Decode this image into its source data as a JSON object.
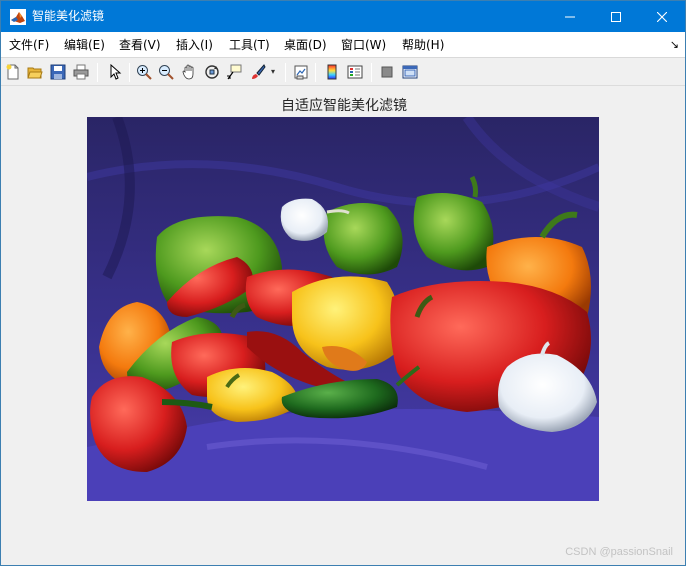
{
  "window": {
    "title": "智能美化滤镜"
  },
  "menu": {
    "items": [
      {
        "label": "文件(F)"
      },
      {
        "label": "编辑(E)"
      },
      {
        "label": "查看(V)"
      },
      {
        "label": "插入(I)"
      },
      {
        "label": "工具(T)"
      },
      {
        "label": "桌面(D)"
      },
      {
        "label": "窗口(W)"
      },
      {
        "label": "帮助(H)"
      }
    ]
  },
  "toolbar": {
    "icons": [
      "new-figure-icon",
      "open-icon",
      "save-icon",
      "print-icon",
      "pointer-icon",
      "zoom-in-icon",
      "zoom-out-icon",
      "pan-icon",
      "rotate-3d-icon",
      "data-cursor-icon",
      "brush-icon",
      "link-plot-icon",
      "colorbar-icon",
      "legend-icon",
      "hide-plot-tools-icon",
      "show-plot-tools-icon"
    ]
  },
  "figure": {
    "title": "自适应智能美化滤镜"
  },
  "watermark": "CSDN @passionSnail",
  "colors": {
    "titlebar": "#0078d7",
    "background": "#f0f0f0",
    "cloth": "#2d2868"
  }
}
